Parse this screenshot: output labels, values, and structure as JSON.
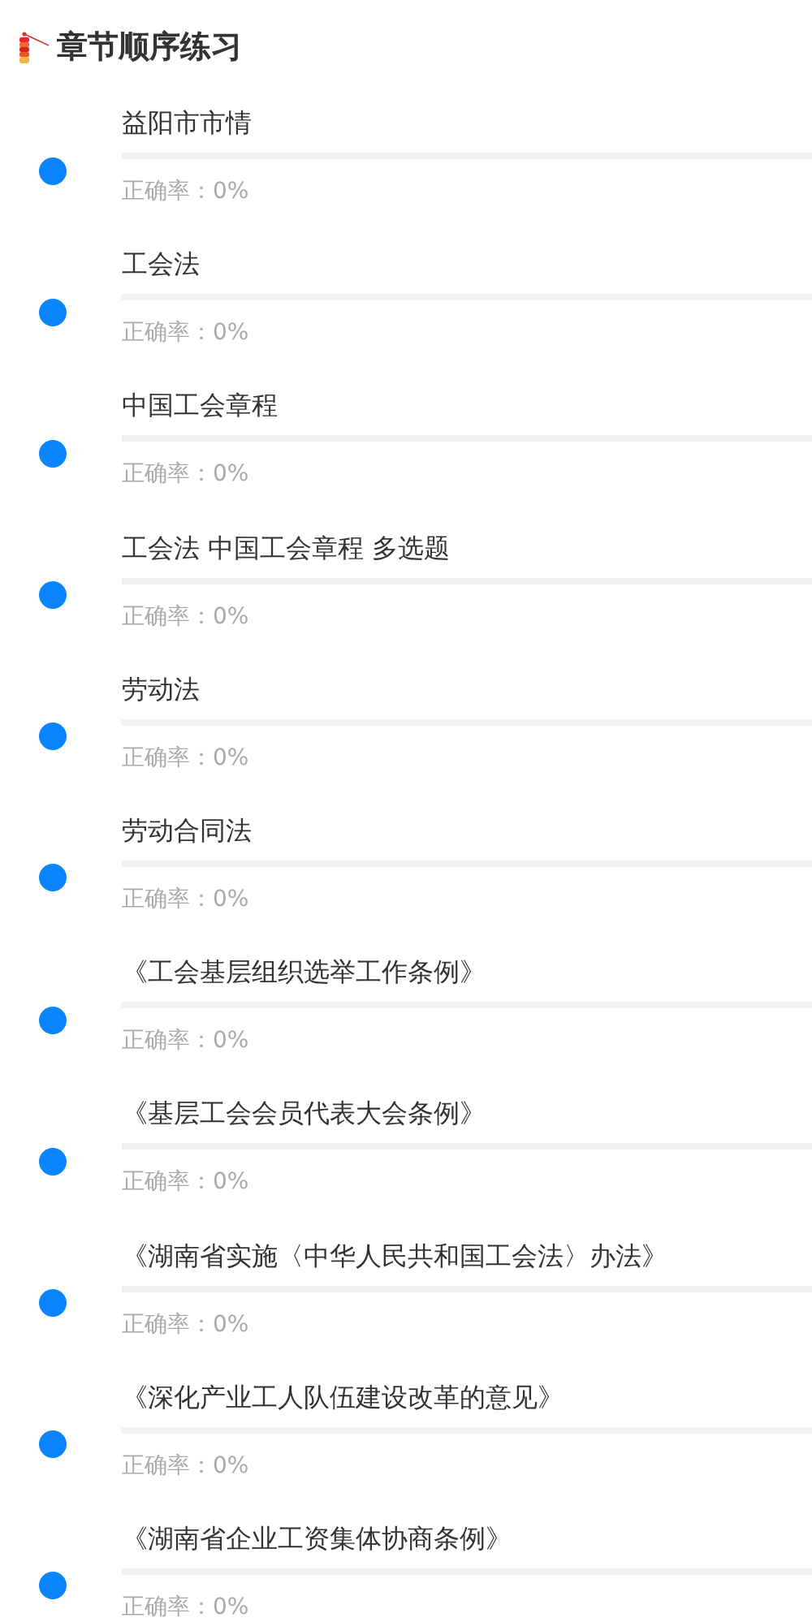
{
  "header": {
    "title": "章节顺序练习"
  },
  "chapters": [
    {
      "title": "益阳市市情",
      "level": 0,
      "accuracy": "正确率：0%"
    },
    {
      "title": "工会法",
      "level": 0,
      "accuracy": "正确率：0%"
    },
    {
      "title": "中国工会章程",
      "level": 0,
      "accuracy": "正确率：0%"
    },
    {
      "title": "工会法 中国工会章程 多选题",
      "level": 0,
      "accuracy": "正确率：0%"
    },
    {
      "title": "劳动法",
      "level": 0,
      "accuracy": "正确率：0%"
    },
    {
      "title": "劳动合同法",
      "level": 0,
      "accuracy": "正确率：0%"
    },
    {
      "title": "《工会基层组织选举工作条例》",
      "level": 0,
      "accuracy": "正确率：0%"
    },
    {
      "title": "《基层工会会员代表大会条例》",
      "level": 0,
      "accuracy": "正确率：0%"
    },
    {
      "title": "《湖南省实施〈中华人民共和国工会法〉办法》",
      "level": 0,
      "accuracy": "正确率：0%"
    },
    {
      "title": "《深化产业工人队伍建设改革的意见》",
      "level": 0,
      "accuracy": "正确率：0%"
    },
    {
      "title": "《湖南省企业工资集体协商条例》",
      "level": 0,
      "accuracy": "正确率：0%"
    }
  ]
}
